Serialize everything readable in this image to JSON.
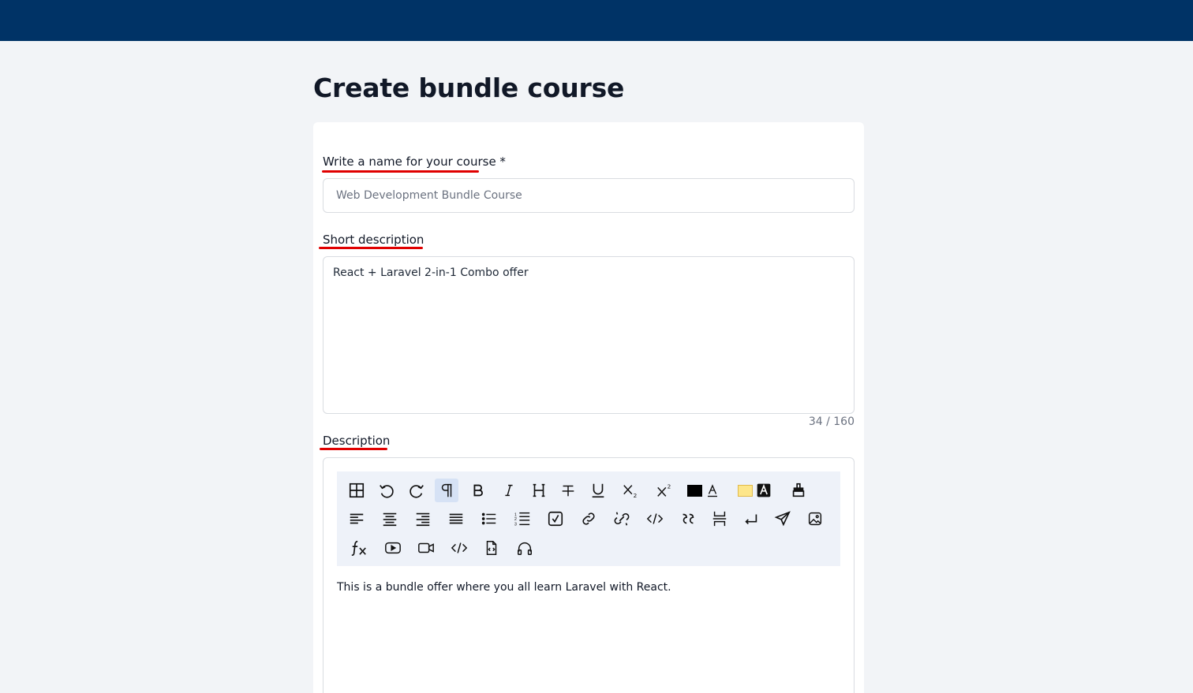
{
  "page": {
    "title": "Create bundle course"
  },
  "form": {
    "name_label": "Write a name for your course *",
    "name_value": "Web Development Bundle Course",
    "short_label": "Short description",
    "short_value": "React + Laravel 2-in-1 Combo offer",
    "short_counter": "34 / 160",
    "desc_label": "Description",
    "desc_content": "This is a bundle offer where you all learn Laravel with React."
  },
  "colors": {
    "topbar": "#003366",
    "underline": "#e00000",
    "font_color_swatch": "#000000",
    "highlight_swatch": "#fde68a"
  },
  "toolbar": {
    "rows": [
      [
        "table-icon",
        "undo-icon",
        "redo-icon",
        "paragraph-icon",
        "bold-icon",
        "italic-icon",
        "heading-icon",
        "strikethrough-icon",
        "underline-icon",
        "subscript-icon",
        "superscript-icon",
        "font-color-icon",
        "highlight-color-icon",
        "clear-format-icon"
      ],
      [
        "align-left-icon",
        "align-center-icon",
        "align-right-icon",
        "align-justify-icon",
        "bullet-list-icon",
        "numbered-list-icon",
        "checklist-icon",
        "link-icon",
        "unlink-icon",
        "code-icon",
        "blockquote-icon",
        "page-break-icon",
        "hard-break-icon",
        "send-icon",
        "image-icon"
      ],
      [
        "formula-icon",
        "youtube-icon",
        "video-icon",
        "embed-code-icon",
        "file-code-icon",
        "audio-icon"
      ]
    ]
  }
}
